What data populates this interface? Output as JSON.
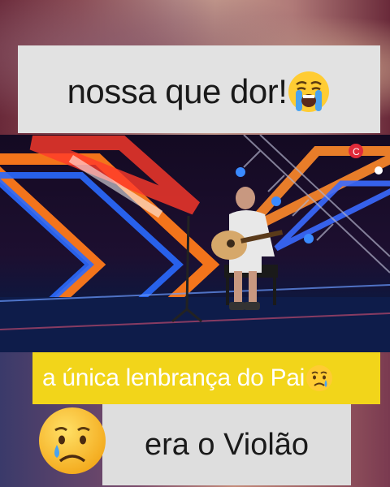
{
  "captions": {
    "top": "nossa que dor!",
    "middle": "a única lenbrança do Pai",
    "bottom": "era o Violão"
  },
  "icons": {
    "top_emoji": "loudly-crying-face-icon",
    "middle_emoji": "crying-face-icon",
    "bottom_emoji": "sad-face-with-tear-icon"
  },
  "colors": {
    "caption_top_bg": "#e2e2e2",
    "caption_middle_bg": "#f2d51a",
    "caption_bottom_bg": "#dedede"
  }
}
